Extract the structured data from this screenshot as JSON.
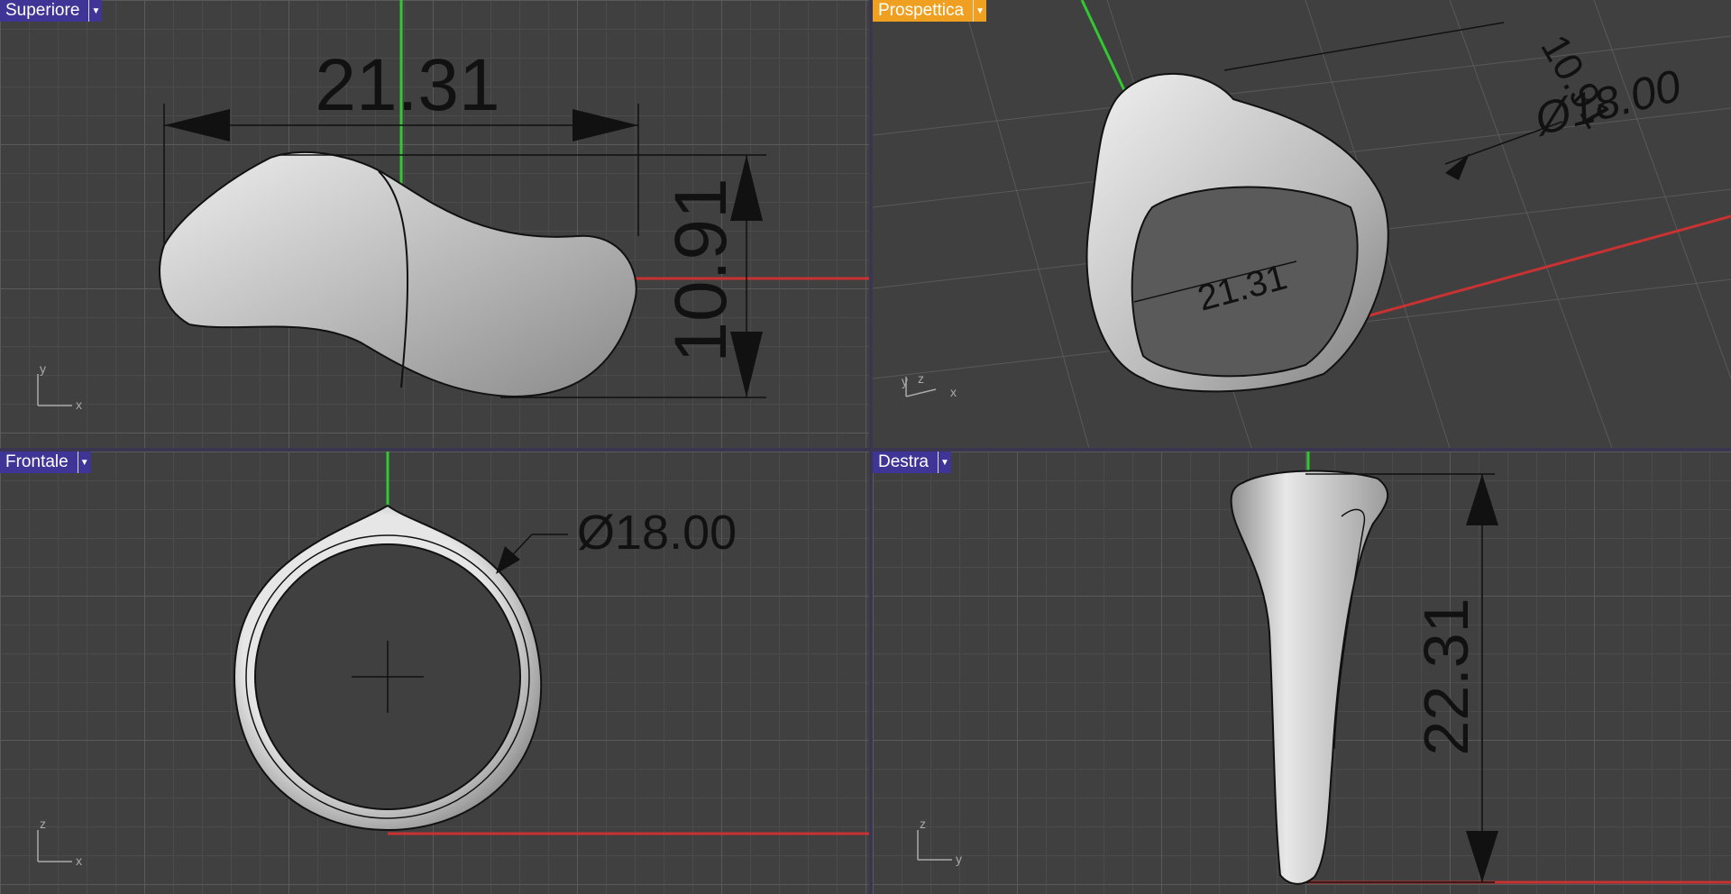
{
  "viewports": {
    "top": {
      "label": "Superiore",
      "dims": {
        "width": "21.31",
        "height": "10.91"
      },
      "axes": {
        "v": "y",
        "h": "x"
      }
    },
    "persp": {
      "label": "Prospettica",
      "dims": {
        "a": "21.31",
        "b": "10.91",
        "c": "Ø18.00"
      },
      "axes": {
        "v": "y",
        "v2": "z",
        "h": "x"
      }
    },
    "front": {
      "label": "Frontale",
      "dims": {
        "diameter": "Ø18.00"
      },
      "axes": {
        "v": "z",
        "h": "x"
      }
    },
    "right": {
      "label": "Destra",
      "dims": {
        "height": "22.31"
      },
      "axes": {
        "v": "z",
        "h": "y"
      }
    }
  },
  "colors": {
    "tab": "#3f3596",
    "tab_active": "#f0a020",
    "x_axis": "#c83232",
    "y_axis": "#32c832",
    "grid_bg": "#404040"
  },
  "icons": {
    "dropdown": "chevron-down-icon"
  }
}
